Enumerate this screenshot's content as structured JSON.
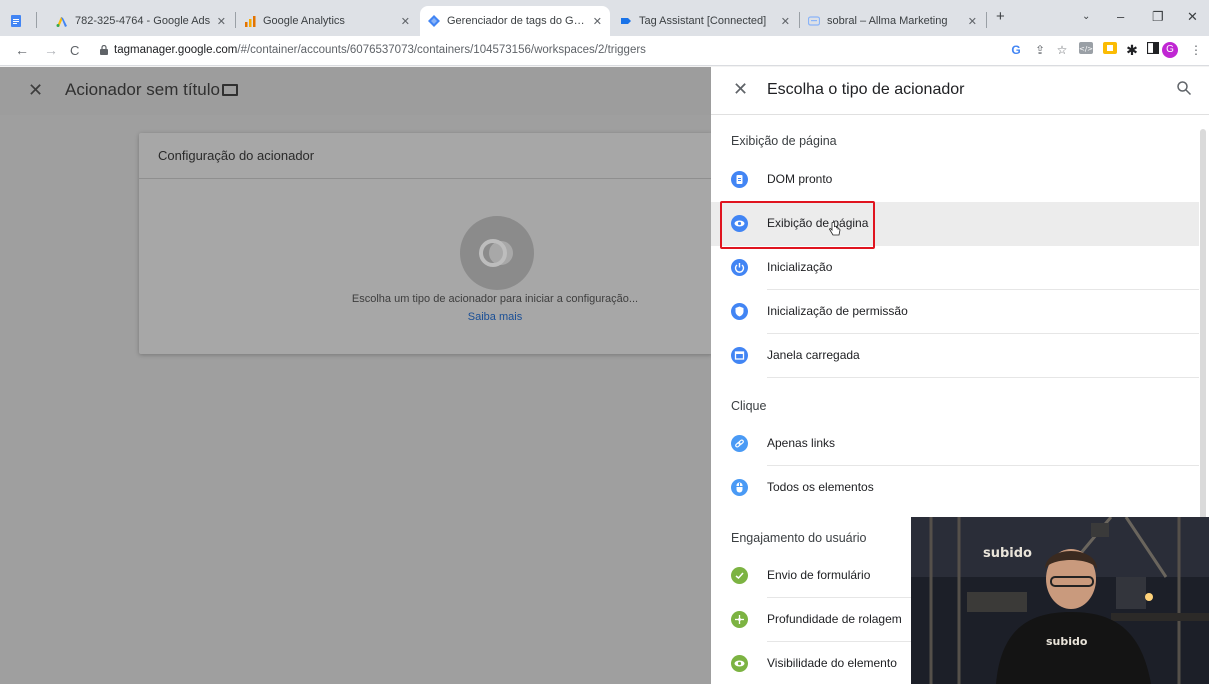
{
  "browser": {
    "tabs": [
      {
        "label": "782-325-4764 - Google Ads",
        "icon": "google-ads-icon",
        "active": false
      },
      {
        "label": "Google Analytics",
        "icon": "google-analytics-icon",
        "active": false
      },
      {
        "label": "Gerenciador de tags do Google",
        "icon": "tag-manager-icon",
        "active": true
      },
      {
        "label": "Tag Assistant [Connected]",
        "icon": "tag-assistant-icon",
        "active": false
      },
      {
        "label": "sobral – Allma Marketing",
        "icon": "site-icon",
        "active": false
      }
    ],
    "new_tab": "+",
    "url_host": "tagmanager.google.com",
    "url_path": "/#/container/accounts/6076537073/containers/104573156/workspaces/2/triggers",
    "profile_initial": "G"
  },
  "editor": {
    "title": "Acionador sem título",
    "card_title": "Configuração do acionador",
    "hint": "Escolha um tipo de acionador para iniciar a configuração...",
    "learn_more": "Saiba mais"
  },
  "panel": {
    "title": "Escolha o tipo de acionador",
    "sections": [
      {
        "label": "Exibição de página",
        "items": [
          {
            "label": "DOM pronto",
            "icon": "document-icon",
            "color": "#4285f4"
          },
          {
            "label": "Exibição de página",
            "icon": "eye-icon",
            "color": "#4285f4"
          },
          {
            "label": "Inicialização",
            "icon": "power-icon",
            "color": "#4285f4"
          },
          {
            "label": "Inicialização de permissão",
            "icon": "shield-icon",
            "color": "#4285f4"
          },
          {
            "label": "Janela carregada",
            "icon": "window-icon",
            "color": "#4285f4"
          }
        ]
      },
      {
        "label": "Clique",
        "items": [
          {
            "label": "Apenas links",
            "icon": "link-icon",
            "color": "#4285f4"
          },
          {
            "label": "Todos os elementos",
            "icon": "mouse-icon",
            "color": "#4285f4"
          }
        ]
      },
      {
        "label": "Engajamento do usuário",
        "items": [
          {
            "label": "Envio de formulário",
            "icon": "form-icon",
            "color": "#7cb342"
          },
          {
            "label": "Profundidade de rolagem",
            "icon": "scroll-icon",
            "color": "#7cb342"
          },
          {
            "label": "Visibilidade do elemento",
            "icon": "eye-icon",
            "color": "#7cb342"
          }
        ]
      }
    ]
  },
  "webcam": {
    "brand_wall": "subido",
    "brand_shirt": "subido"
  }
}
